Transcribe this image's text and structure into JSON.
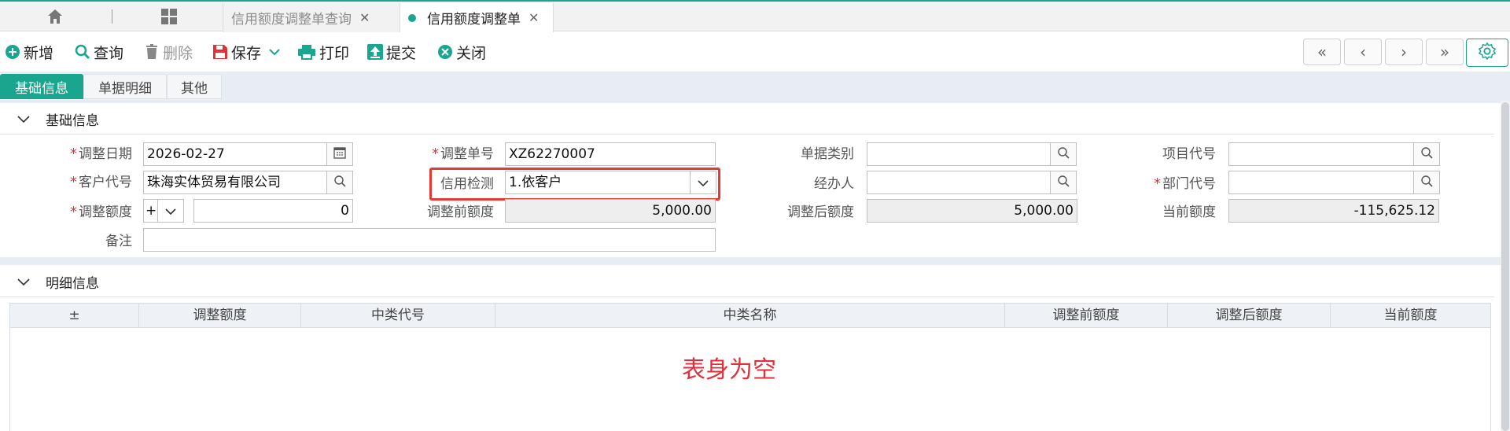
{
  "tabs": [
    {
      "label": "信用额度调整单查询",
      "active": false
    },
    {
      "label": "信用额度调整单",
      "active": true
    }
  ],
  "toolbar": {
    "add": "新增",
    "query": "查询",
    "delete": "删除",
    "save": "保存",
    "print": "打印",
    "submit": "提交",
    "close": "关闭"
  },
  "subtabs": [
    "基础信息",
    "单据明细",
    "其他"
  ],
  "sections": {
    "basic": "基础信息",
    "detail": "明细信息"
  },
  "form": {
    "adjust_date_label": "调整日期",
    "adjust_date": "2026-02-27",
    "adjust_no_label": "调整单号",
    "adjust_no": "XZ62270007",
    "doc_type_label": "单据类别",
    "doc_type": "",
    "project_code_label": "项目代号",
    "project_code": "",
    "customer_code_label": "客户代号",
    "customer_code": "珠海实体贸易有限公司",
    "credit_check_label": "信用检测",
    "credit_check": "1.依客户",
    "handler_label": "经办人",
    "handler": "",
    "dept_code_label": "部门代号",
    "dept_code": "",
    "adjust_amount_label": "调整额度",
    "sign": "+",
    "adjust_amount": "0",
    "before_amount_label": "调整前额度",
    "before_amount": "5,000.00",
    "after_amount_label": "调整后额度",
    "after_amount": "5,000.00",
    "current_amount_label": "当前额度",
    "current_amount": "-115,625.12",
    "remark_label": "备注",
    "remark": ""
  },
  "grid": {
    "columns": [
      "±",
      "调整额度",
      "中类代号",
      "中类名称",
      "调整前额度",
      "调整后额度",
      "当前额度"
    ],
    "empty_text": "表身为空"
  },
  "colors": {
    "accent": "#1aa68e",
    "required": "#e0313b",
    "highlight": "#e53935"
  }
}
